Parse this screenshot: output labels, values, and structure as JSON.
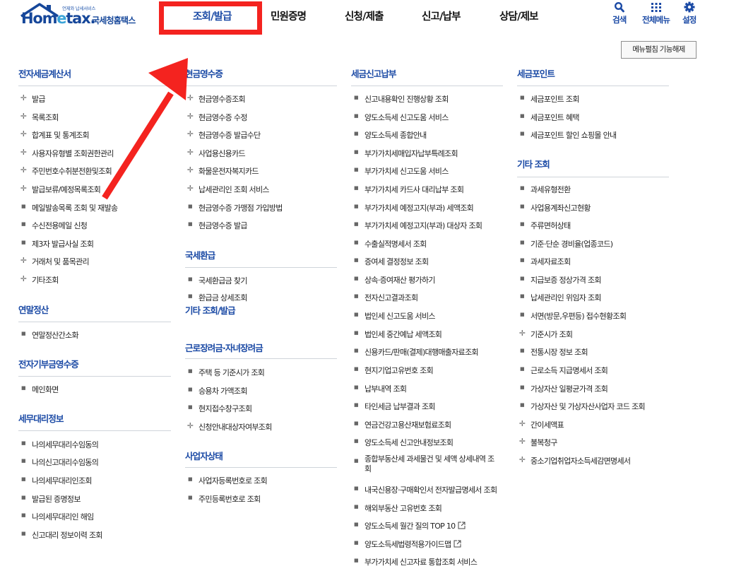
{
  "logo": {
    "tagline": "언제와 납세서비스",
    "word_a": "Hom",
    "word_e": "e",
    "word_b": "tax.",
    "korean": "국세청홈택스"
  },
  "gnb": [
    {
      "label": "조회/발급"
    },
    {
      "label": "민원증명"
    },
    {
      "label": "신청/제출"
    },
    {
      "label": "신고/납부"
    },
    {
      "label": "상담/제보"
    }
  ],
  "utility": {
    "search": "검색",
    "all_menu": "전체메뉴",
    "settings": "설정"
  },
  "menu_open_button": "메뉴펼침 기능해제",
  "columns": {
    "col1": {
      "sections": [
        {
          "title": "전자세금계산서",
          "items": [
            "발급",
            "목록조회",
            "합계표 및 통계조회",
            "사용자유형별 조회권한관리",
            "주민번호수취분전환및조회",
            "발급보류/예정목록조회",
            "메일발송목록 조회 및 재발송",
            "수신전용메일 신청",
            "제3자 발급사실 조회",
            "거래처 및 품목관리",
            "기타조회"
          ]
        },
        {
          "title": "연말정산",
          "items": [
            "연말정산간소화"
          ]
        },
        {
          "title": "전자기부금영수증",
          "items": [
            "메인화면"
          ]
        },
        {
          "title": "세무대리정보",
          "items": [
            "나의세무대리수임동의",
            "나의신고대리수임동의",
            "나의세무대리인조회",
            "발급된 증명정보",
            "나의세무대리인 해임",
            "신고대리 정보이력 조회"
          ]
        }
      ]
    },
    "col2": {
      "sections": [
        {
          "title": "현금영수증",
          "items": [
            "현금영수증조회",
            "현금영수증 수정",
            "현금영수증 발급수단",
            "사업용신용카드",
            "화물운전자복지카드",
            "납세관리인 조회 서비스",
            "현금영수증 가맹점 가입방법",
            "현금영수증 발급"
          ]
        },
        {
          "title": "국세환급",
          "items": [
            "국세환급금 찾기",
            "환급금 상세조회"
          ]
        },
        {
          "title": "기타 조회/발급",
          "items": []
        },
        {
          "title": "근로장려금·자녀장려금",
          "items": [
            "주택 등 기준시가 조회",
            "승용차 가액조회",
            "현지접수창구조회",
            "신청안내대상자여부조회"
          ]
        },
        {
          "title": "사업자상태",
          "items": [
            "사업자등록번호로 조회",
            "주민등록번호로 조회"
          ]
        }
      ]
    },
    "col3": {
      "sections": [
        {
          "title": "세금신고납부",
          "items": [
            "신고내용확인 진행상황 조회",
            "양도소득세 신고도움 서비스",
            "양도소득세 종합안내",
            "부가가치세매입자납부특례조회",
            "부가가치세 신고도움 서비스",
            "부가가치세 카드사 대리납부 조회",
            "부가가치세 예정고지(부과) 세액조회",
            "부가가치세 예정고지(부과) 대상자 조회",
            "수출실적명세서 조회",
            "증여세 결정정보 조회",
            "상속·증여재산 평가하기",
            "전자신고결과조회",
            "법인세 신고도움 서비스",
            "법인세 중간예납 세액조회",
            "신용카드/판매(결제)대행매출자료조회",
            "현지기업고유번호 조회",
            "납부내역 조회",
            "타인세금 납부결과 조회",
            "연금건강고용산재보험료조회",
            "양도소득세 신고안내정보조회",
            "종합부동산세 과세물건 및 세액 상세내역 조회",
            "내국신용장·구매확인서 전자발급명세서 조회",
            "해외부동산 고유번호 조회",
            "양도소득세 월간 질의 TOP 10",
            "양도소득세법령적용가이드맵",
            "부가가치세 신고자료 통합조회 서비스"
          ]
        }
      ]
    },
    "col4": {
      "sections": [
        {
          "title": "세금포인트",
          "items": [
            "세금포인트 조회",
            "세금포인트 혜택",
            "세금포인트 할인 쇼핑몰 안내"
          ]
        },
        {
          "title": "기타 조회",
          "items": [
            "과세유형전환",
            "사업용계좌신고현황",
            "주류면허상태",
            "기준·단순 경비율(업종코드)",
            "과세자료조회",
            "지급보증 정상가격 조회",
            "납세관리인 위임자 조회",
            "서면(방문,우편등) 접수현황조회",
            "기준시가 조회",
            "전통시장 정보 조회",
            "근로소득 지급명세서 조회",
            "가상자산 일평균가격 조회",
            "가상자산 및 가상자산사업자 코드 조회",
            "간이세액표",
            "불복청구",
            "중소기업취업자소득세감면명세서"
          ]
        }
      ]
    }
  },
  "icons": {
    "expand": "crosshair-plus-icon",
    "bullet": "square-bullet-icon",
    "external": "external-link-icon",
    "search": "search-icon",
    "grid": "grid-icon",
    "gear": "gear-icon",
    "arrow": "red-arrow-annotation"
  },
  "colors": {
    "brand_blue": "#1b4aa5",
    "highlight_red": "#f4231f",
    "text": "#222222"
  }
}
